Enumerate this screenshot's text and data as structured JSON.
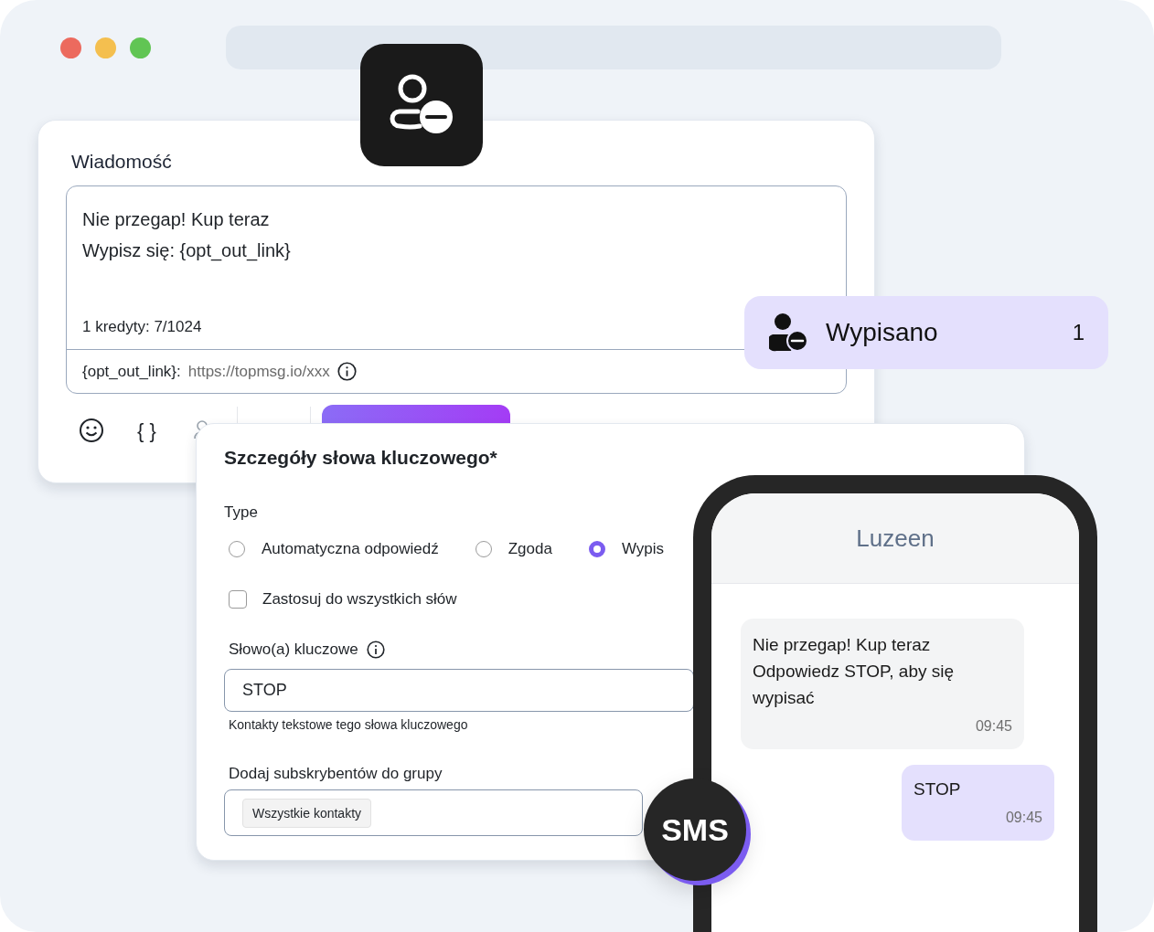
{
  "window": {
    "dots": [
      {
        "color": "#ec6a5e"
      },
      {
        "color": "#f4bf4f"
      },
      {
        "color": "#61c554"
      }
    ]
  },
  "message_card": {
    "label": "Wiadomość",
    "lines": [
      "Nie przegap! Kup teraz",
      "Wypisz się: {opt_out_link}"
    ],
    "credits": "1 kredyty: 7/1024",
    "link_label": "{opt_out_link}:",
    "link_value": "https://topmsg.io/xxx",
    "variables_button": "{ }"
  },
  "status_chip": {
    "label": "Wypisano",
    "count": "1"
  },
  "keyword_card": {
    "title": "Szczegóły słowa kluczowego*",
    "type_label": "Type",
    "options": [
      {
        "label": "Automatyczna odpowiedź",
        "selected": false
      },
      {
        "label": "Zgoda",
        "selected": false
      },
      {
        "label": "Wypis",
        "selected": true
      }
    ],
    "apply_all": {
      "label": "Zastosuj do wszystkich słów",
      "checked": false
    },
    "keyword_label": "Słowo(a) kluczowe",
    "keyword_value": "STOP",
    "keyword_hint": "Kontakty tekstowe tego słowa kluczowego",
    "group_label": "Dodaj subskrybentów do grupy",
    "group_tags": [
      "Wszystkie kontakty"
    ]
  },
  "phone": {
    "contact": "Luzeen",
    "messages": [
      {
        "kind": "incoming",
        "paragraphs": [
          "Nie przegap! Kup teraz",
          "Odpowiedz STOP, aby się wypisać"
        ],
        "time": "09:45"
      },
      {
        "kind": "outgoing",
        "paragraphs": [
          "STOP"
        ],
        "time": "09:45"
      }
    ]
  },
  "sms_badge": {
    "label": "SMS"
  }
}
